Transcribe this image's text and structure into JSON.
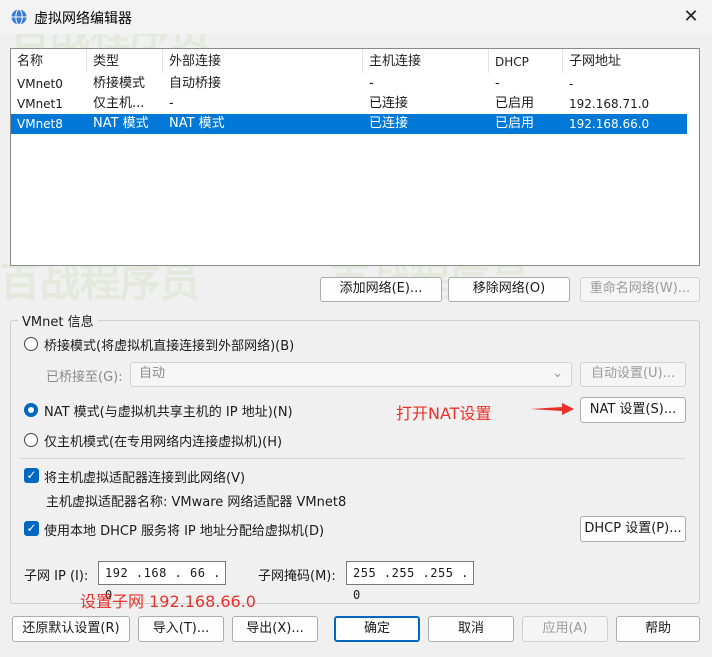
{
  "window": {
    "title": "虚拟网络编辑器",
    "close_glyph": "✕"
  },
  "table": {
    "headers": [
      "名称",
      "类型",
      "外部连接",
      "主机连接",
      "DHCP",
      "子网地址"
    ],
    "rows": [
      [
        "VMnet0",
        "桥接模式",
        "自动桥接",
        "-",
        "-",
        "-"
      ],
      [
        "VMnet1",
        "仅主机...",
        "-",
        "已连接",
        "已启用",
        "192.168.71.0"
      ],
      [
        "VMnet8",
        "NAT 模式",
        "NAT 模式",
        "已连接",
        "已启用",
        "192.168.66.0"
      ]
    ],
    "selected_row": 2
  },
  "list_buttons": {
    "add": "添加网络(E)...",
    "remove": "移除网络(O)",
    "rename": "重命名网络(W)..."
  },
  "vmnet_info": {
    "legend": "VMnet 信息",
    "bridge_label": "桥接模式(将虚拟机直接连接到外部网络)(B)",
    "bridged_to_label": "已桥接至(G):",
    "bridged_to_value": "自动",
    "auto_settings": "自动设置(U)...",
    "nat_label": "NAT 模式(与虚拟机共享主机的 IP 地址)(N)",
    "nat_settings": "NAT 设置(S)...",
    "hostonly_label": "仅主机模式(在专用网络内连接虚拟机)(H)",
    "selected_mode": "nat",
    "connect_adapter_label": "将主机虚拟适配器连接到此网络(V)",
    "connect_adapter_checked": true,
    "adapter_name_label": "主机虚拟适配器名称: VMware 网络适配器 VMnet8",
    "dhcp_label": "使用本地 DHCP 服务将 IP 地址分配给虚拟机(D)",
    "dhcp_checked": true,
    "dhcp_settings": "DHCP 设置(P)...",
    "subnet_ip_label": "子网 IP (I):",
    "subnet_ip_value": "192 .168 . 66 .  0",
    "subnet_mask_label": "子网掩码(M):",
    "subnet_mask_value": "255 .255 .255 .  0"
  },
  "annotations": {
    "open_nat": "打开NAT设置",
    "set_subnet": "设置子网 192.168.66.0",
    "color": "#e8312a"
  },
  "footer": {
    "restore": "还原默认设置(R)",
    "import": "导入(T)...",
    "export": "导出(X)...",
    "ok": "确定",
    "cancel": "取消",
    "apply": "应用(A)",
    "help": "帮助"
  },
  "watermark": "百战程序员",
  "colors": {
    "accent": "#0078d7",
    "checkbox": "#0067c0"
  }
}
